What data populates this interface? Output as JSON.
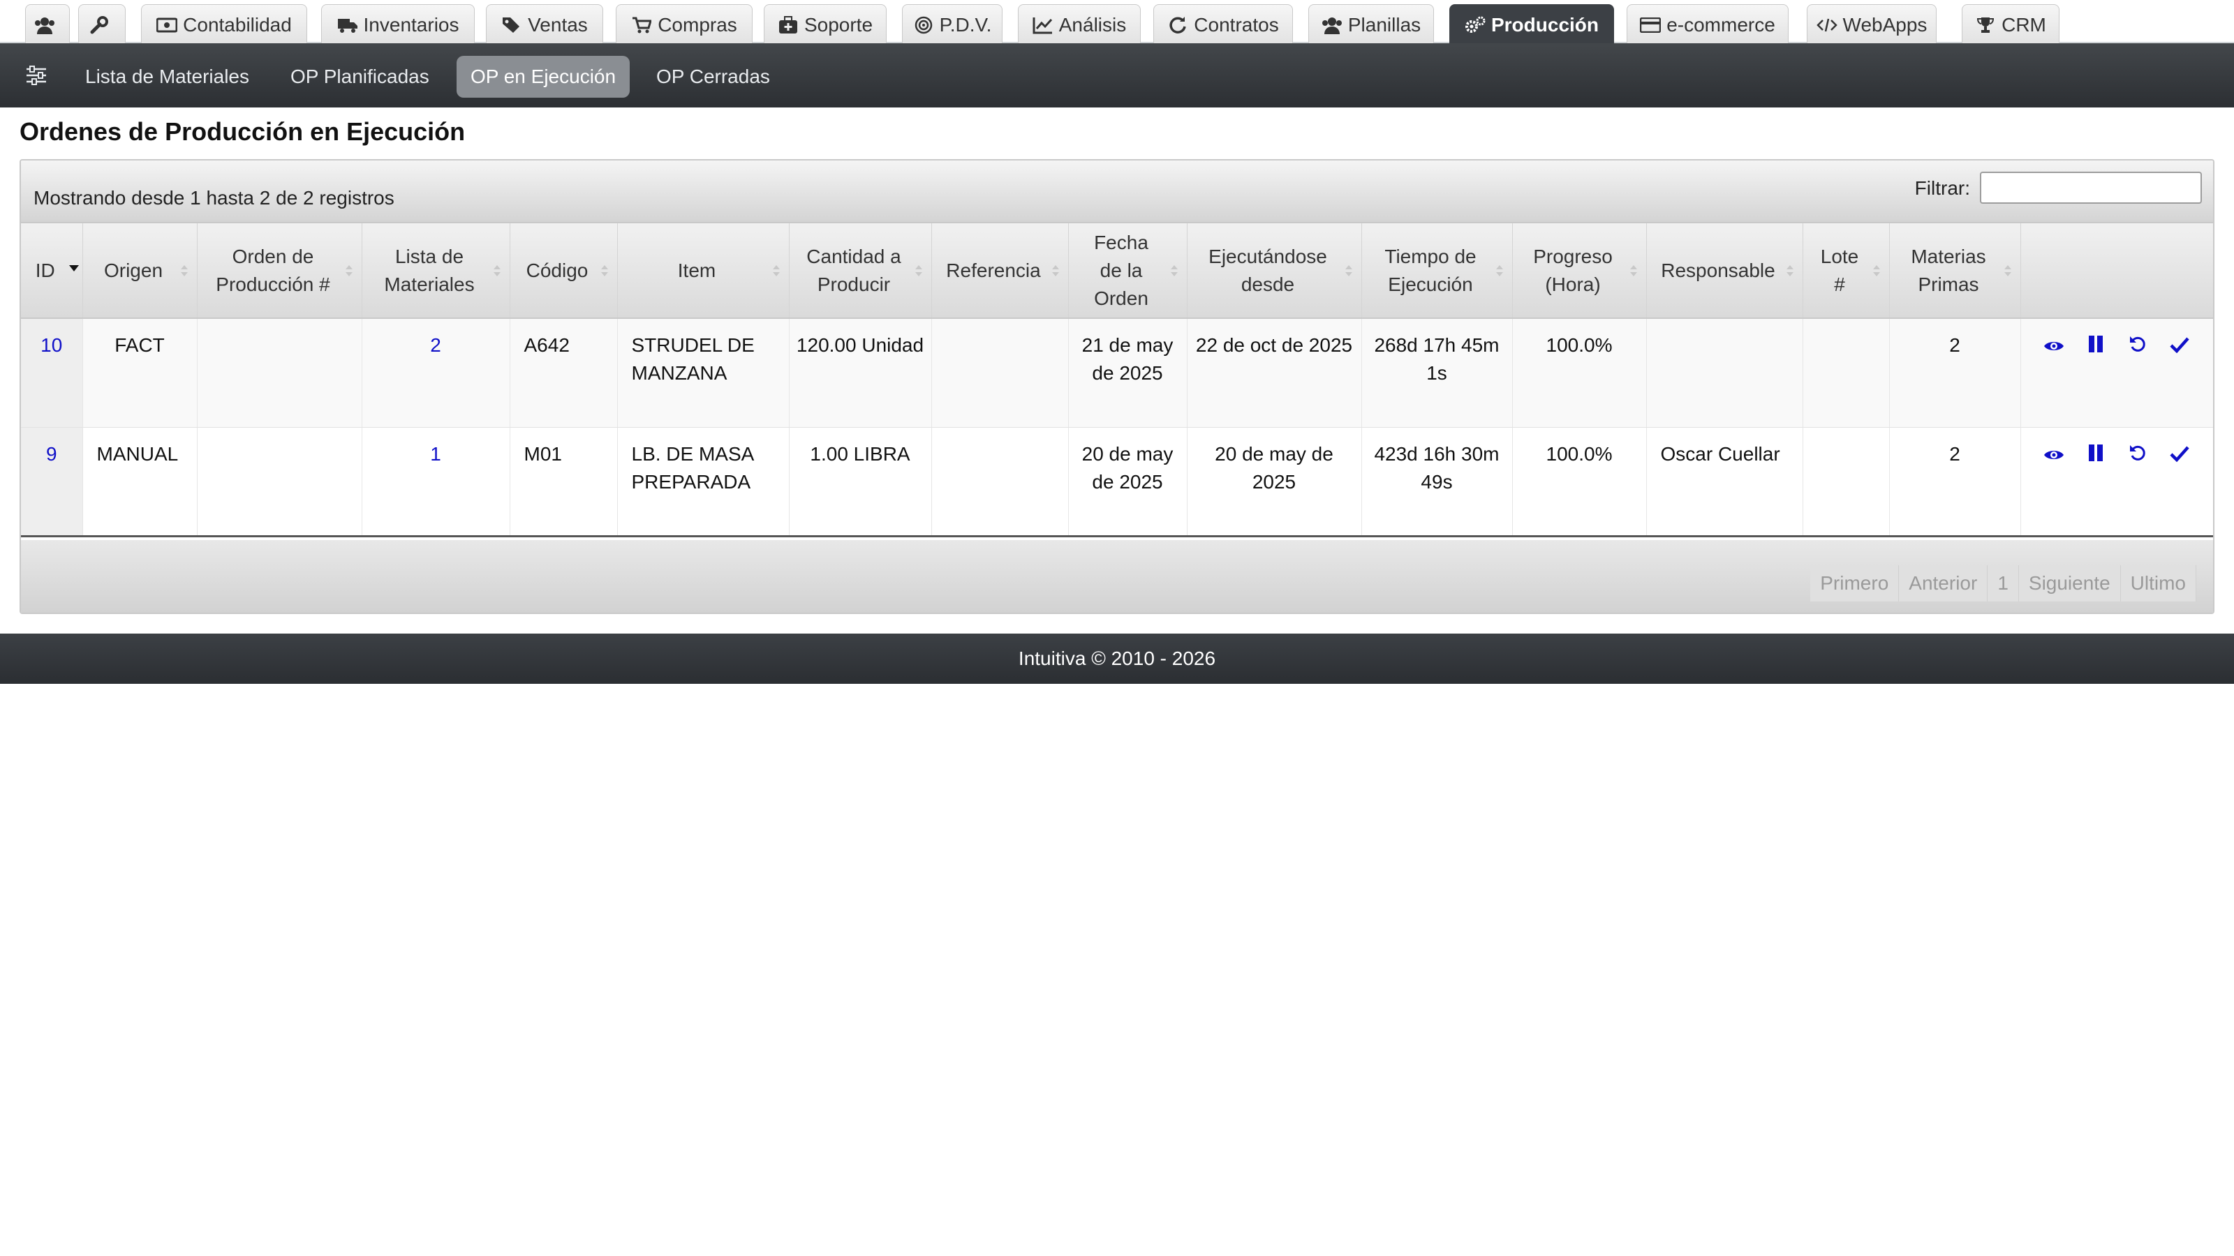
{
  "tabs": [
    {
      "label": "",
      "icon": "users-icon"
    },
    {
      "label": "",
      "icon": "wrench-icon"
    },
    {
      "label": "Contabilidad",
      "icon": "money-icon"
    },
    {
      "label": "Inventarios",
      "icon": "truck-icon"
    },
    {
      "label": "Ventas",
      "icon": "tags-icon"
    },
    {
      "label": "Compras",
      "icon": "cart-icon"
    },
    {
      "label": "Soporte",
      "icon": "medkit-icon"
    },
    {
      "label": "P.D.V.",
      "icon": "target-icon"
    },
    {
      "label": "Análisis",
      "icon": "chart-line-icon"
    },
    {
      "label": "Contratos",
      "icon": "refresh-icon"
    },
    {
      "label": "Planillas",
      "icon": "users-icon"
    },
    {
      "label": "Producción",
      "icon": "gears-icon",
      "active": true
    },
    {
      "label": "e-commerce",
      "icon": "credit-card-icon"
    },
    {
      "label": "WebApps",
      "icon": "code-icon"
    },
    {
      "label": "CRM",
      "icon": "trophy-icon"
    }
  ],
  "subnav": {
    "items": [
      "Lista de Materiales",
      "OP Planificadas",
      "OP en Ejecución",
      "OP Cerradas"
    ],
    "active": "OP en Ejecución"
  },
  "page": {
    "title": "Ordenes de Producción en Ejecución"
  },
  "table": {
    "info": "Mostrando desde 1 hasta 2 de 2 registros",
    "filter_label": "Filtrar:",
    "filter_value": "",
    "columns": [
      "ID",
      "Origen",
      "Orden de\nProducción #",
      "Lista de\nMateriales",
      "Código",
      "Item",
      "Cantidad a\nProducir",
      "Referencia",
      "Fecha\nde la\nOrden",
      "Ejecutándose\ndesde",
      "Tiempo de\nEjecución",
      "Progreso\n(Hora)",
      "Responsable",
      "Lote\n#",
      "Materias\nPrimas",
      ""
    ],
    "sorted_column": "ID",
    "rows": [
      {
        "id": "10",
        "origen": "FACT",
        "orden": "",
        "lista": "2",
        "codigo": "A642",
        "item": "STRUDEL DE MANZANA",
        "cantidad": "120.00 Unidad",
        "referencia": "",
        "fecha": "21 de may de 2025",
        "desde": "22 de oct de 2025",
        "tiempo": "268d 17h 45m 1s",
        "progreso": "100.0%",
        "responsable": "",
        "lote": "",
        "materias": "2"
      },
      {
        "id": "9",
        "origen": "MANUAL",
        "orden": "",
        "lista": "1",
        "codigo": "M01",
        "item": "LB. DE MASA PREPARADA",
        "cantidad": "1.00 LIBRA",
        "referencia": "",
        "fecha": "20 de may de 2025",
        "desde": "20 de may de 2025",
        "tiempo": "423d 16h 30m 49s",
        "progreso": "100.0%",
        "responsable": "Oscar Cuellar",
        "lote": "",
        "materias": "2"
      }
    ],
    "actions": [
      "view-icon",
      "pause-icon",
      "undo-icon",
      "check-icon"
    ],
    "action_color": "#1010c8"
  },
  "pager": [
    "Primero",
    "Anterior",
    "1",
    "Siguiente",
    "Ultimo"
  ],
  "footer": {
    "text": "Intuitiva © 2010 - 2026"
  },
  "colors": {
    "nav_dark": "#3c4045",
    "link": "#1010c8",
    "active_subnav": "#8a8e93"
  }
}
